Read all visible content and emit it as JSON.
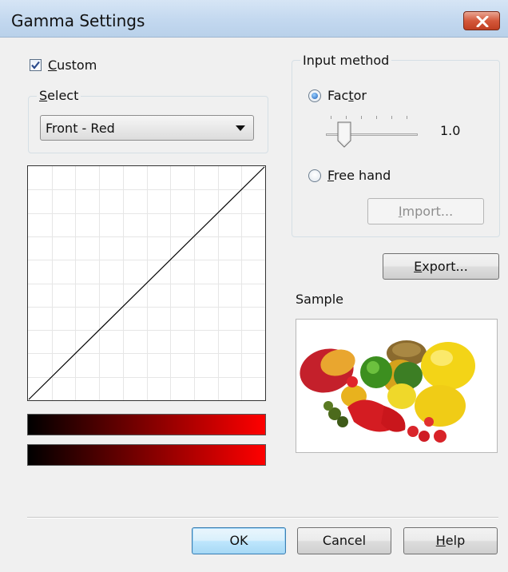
{
  "window": {
    "title": "Gamma Settings"
  },
  "custom": {
    "label_underlined": "C",
    "label_rest": "ustom",
    "checked": true
  },
  "select_group": {
    "title_underlined": "S",
    "title_rest": "elect",
    "value": "Front - Red"
  },
  "input_method": {
    "title": "Input method",
    "factor": {
      "label_pre": "Fac",
      "label_underlined": "t",
      "label_post": "or",
      "selected": true,
      "value": "1.0"
    },
    "free_hand": {
      "label_underlined": "F",
      "label_rest": "ree hand",
      "selected": false
    },
    "import_button": {
      "label_underlined": "I",
      "label_rest": "mport...",
      "enabled": false
    }
  },
  "export_button": {
    "label_underlined": "E",
    "label_rest": "xport..."
  },
  "sample": {
    "label": "Sample"
  },
  "gradient": {
    "start_color": "#000000",
    "end_color": "#ff0000"
  },
  "footer": {
    "ok_label": "OK",
    "cancel_label": "Cancel",
    "help_underlined": "H",
    "help_rest": "elp"
  },
  "colors": {
    "curve": "#000000",
    "grid": "#e6e6e6",
    "accent": "#3c7fb1"
  }
}
